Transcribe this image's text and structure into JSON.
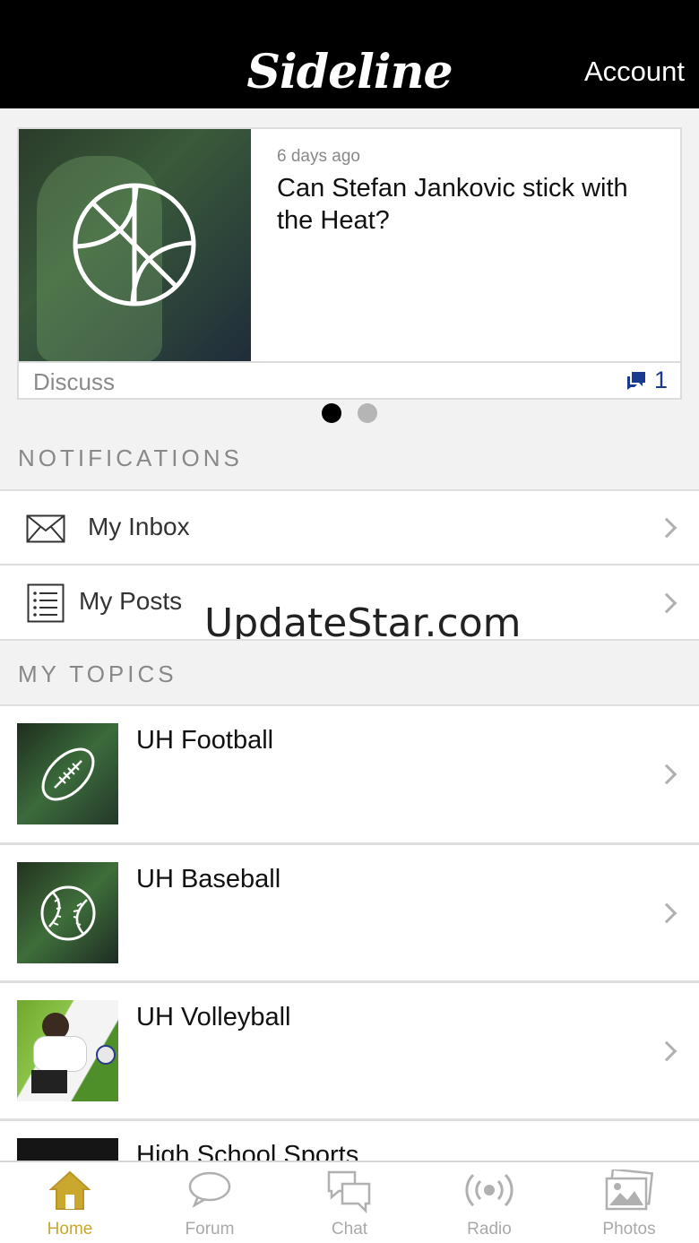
{
  "header": {
    "logo": "Sideline",
    "account": "Account"
  },
  "featured": {
    "time": "6 days ago",
    "title": "Can Stefan Jankovic stick with the Heat?",
    "discuss": "Discuss",
    "comment_count": "1",
    "icon": "basketball-icon"
  },
  "carousel": {
    "pages": 2,
    "active": 1
  },
  "notifications": {
    "heading": "NOTIFICATIONS",
    "items": [
      {
        "label": "My Inbox",
        "icon": "envelope-icon"
      },
      {
        "label": "My Posts",
        "icon": "list-icon"
      }
    ]
  },
  "watermark": "UpdateStar.com",
  "topics": {
    "heading": "MY TOPICS",
    "items": [
      {
        "label": "UH Football",
        "icon": "football-icon"
      },
      {
        "label": "UH Baseball",
        "icon": "baseball-icon"
      },
      {
        "label": "UH Volleyball",
        "icon": "volleyball-photo"
      },
      {
        "label": "High School Sports",
        "icon": ""
      }
    ]
  },
  "tabs": [
    {
      "label": "Home",
      "icon": "home-icon",
      "active": true
    },
    {
      "label": "Forum",
      "icon": "speech-bubble-icon"
    },
    {
      "label": "Chat",
      "icon": "chat-bubbles-icon"
    },
    {
      "label": "Radio",
      "icon": "radio-icon"
    },
    {
      "label": "Photos",
      "icon": "photos-icon"
    }
  ],
  "colors": {
    "accent": "#c9a82d",
    "link": "#1a3a8f",
    "header_bg": "#000000",
    "topic_green": "#2f5a2f"
  }
}
